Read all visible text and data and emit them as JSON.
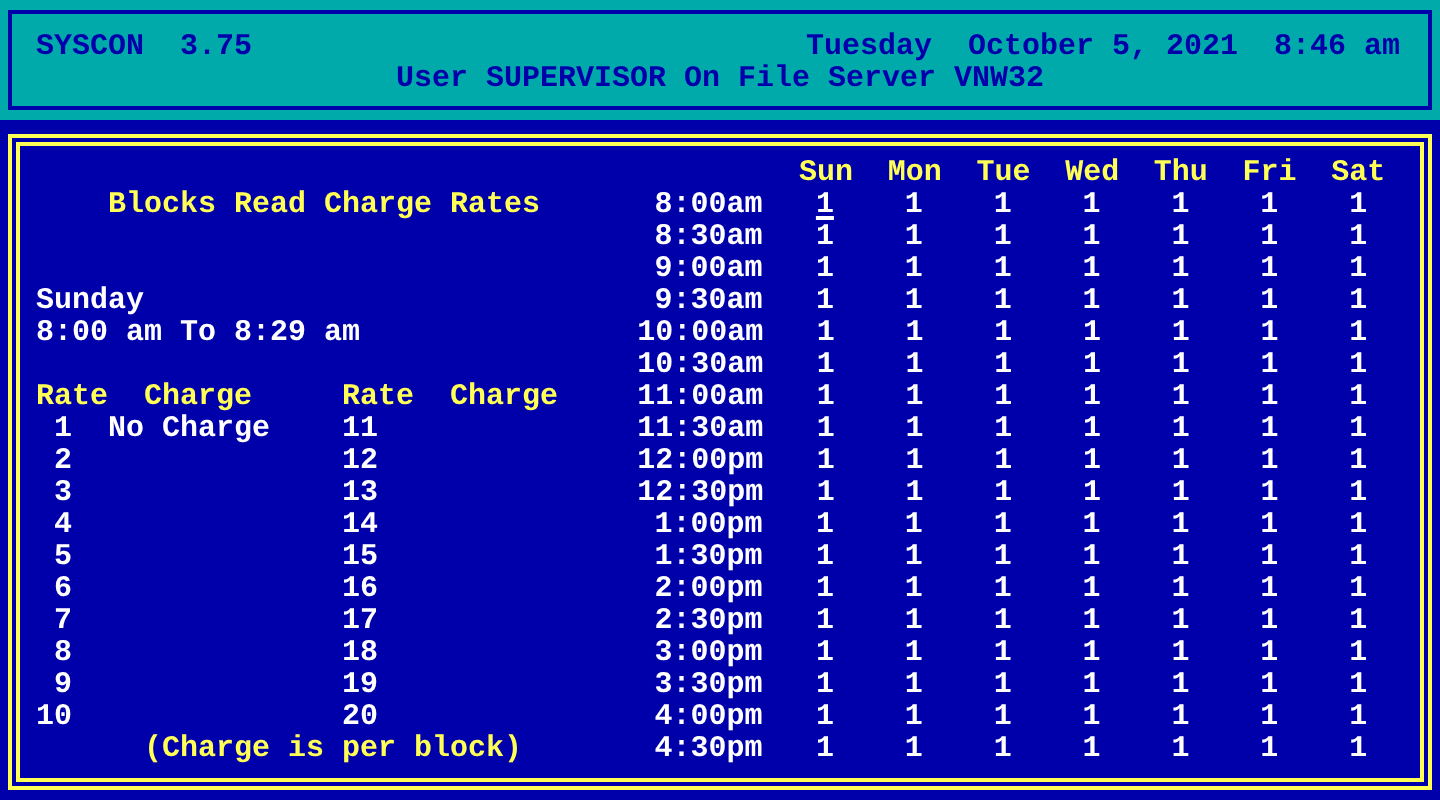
{
  "header": {
    "app": "SYSCON",
    "version": "3.75",
    "datetime": "Tuesday  October 5, 2021  8:46 am",
    "user_line": "User SUPERVISOR On File Server VNW32"
  },
  "left": {
    "heading": "Blocks Read Charge Rates",
    "day": "Sunday",
    "range": "8:00 am To 8:29 am",
    "rate_columns": [
      "Rate",
      "Charge",
      "Rate",
      "Charge"
    ],
    "rates": [
      {
        "rate": "1",
        "charge": "No Charge",
        "rate_2": "11"
      },
      {
        "rate": "2",
        "rate_2": "12"
      },
      {
        "rate": "3",
        "rate_2": "13"
      },
      {
        "rate": "4",
        "rate_2": "14"
      },
      {
        "rate": "5",
        "rate_2": "15"
      },
      {
        "rate": "6",
        "rate_2": "16"
      },
      {
        "rate": "7",
        "rate_2": "17"
      },
      {
        "rate": "8",
        "rate_2": "18"
      },
      {
        "rate": "9",
        "rate_2": "19"
      },
      {
        "rate": "10",
        "rate_2": "20"
      }
    ],
    "footnote": "(Charge is per block)"
  },
  "days": [
    "Sun",
    "Mon",
    "Tue",
    "Wed",
    "Thu",
    "Fri",
    "Sat"
  ],
  "rows": [
    {
      "time": "8:00am",
      "cells": [
        {
          "value": "1",
          "selected": true
        },
        {
          "value": "1",
          "selected": false
        },
        {
          "value": "1",
          "selected": false
        },
        {
          "value": "1",
          "selected": false
        },
        {
          "value": "1",
          "selected": false
        },
        {
          "value": "1",
          "selected": false
        },
        {
          "value": "1",
          "selected": false
        }
      ]
    },
    {
      "time": "8:30am",
      "cells": [
        {
          "value": "1",
          "selected": false
        },
        {
          "value": "1",
          "selected": false
        },
        {
          "value": "1",
          "selected": false
        },
        {
          "value": "1",
          "selected": false
        },
        {
          "value": "1",
          "selected": false
        },
        {
          "value": "1",
          "selected": false
        },
        {
          "value": "1",
          "selected": false
        }
      ]
    },
    {
      "time": "9:00am",
      "cells": [
        {
          "value": "1",
          "selected": false
        },
        {
          "value": "1",
          "selected": false
        },
        {
          "value": "1",
          "selected": false
        },
        {
          "value": "1",
          "selected": false
        },
        {
          "value": "1",
          "selected": false
        },
        {
          "value": "1",
          "selected": false
        },
        {
          "value": "1",
          "selected": false
        }
      ]
    },
    {
      "time": "9:30am",
      "cells": [
        {
          "value": "1",
          "selected": false
        },
        {
          "value": "1",
          "selected": false
        },
        {
          "value": "1",
          "selected": false
        },
        {
          "value": "1",
          "selected": false
        },
        {
          "value": "1",
          "selected": false
        },
        {
          "value": "1",
          "selected": false
        },
        {
          "value": "1",
          "selected": false
        }
      ]
    },
    {
      "time": "10:00am",
      "cells": [
        {
          "value": "1",
          "selected": false
        },
        {
          "value": "1",
          "selected": false
        },
        {
          "value": "1",
          "selected": false
        },
        {
          "value": "1",
          "selected": false
        },
        {
          "value": "1",
          "selected": false
        },
        {
          "value": "1",
          "selected": false
        },
        {
          "value": "1",
          "selected": false
        }
      ]
    },
    {
      "time": "10:30am",
      "cells": [
        {
          "value": "1",
          "selected": false
        },
        {
          "value": "1",
          "selected": false
        },
        {
          "value": "1",
          "selected": false
        },
        {
          "value": "1",
          "selected": false
        },
        {
          "value": "1",
          "selected": false
        },
        {
          "value": "1",
          "selected": false
        },
        {
          "value": "1",
          "selected": false
        }
      ]
    },
    {
      "time": "11:00am",
      "cells": [
        {
          "value": "1",
          "selected": false
        },
        {
          "value": "1",
          "selected": false
        },
        {
          "value": "1",
          "selected": false
        },
        {
          "value": "1",
          "selected": false
        },
        {
          "value": "1",
          "selected": false
        },
        {
          "value": "1",
          "selected": false
        },
        {
          "value": "1",
          "selected": false
        }
      ]
    },
    {
      "time": "11:30am",
      "cells": [
        {
          "value": "1",
          "selected": false
        },
        {
          "value": "1",
          "selected": false
        },
        {
          "value": "1",
          "selected": false
        },
        {
          "value": "1",
          "selected": false
        },
        {
          "value": "1",
          "selected": false
        },
        {
          "value": "1",
          "selected": false
        },
        {
          "value": "1",
          "selected": false
        }
      ]
    },
    {
      "time": "12:00pm",
      "cells": [
        {
          "value": "1",
          "selected": false
        },
        {
          "value": "1",
          "selected": false
        },
        {
          "value": "1",
          "selected": false
        },
        {
          "value": "1",
          "selected": false
        },
        {
          "value": "1",
          "selected": false
        },
        {
          "value": "1",
          "selected": false
        },
        {
          "value": "1",
          "selected": false
        }
      ]
    },
    {
      "time": "12:30pm",
      "cells": [
        {
          "value": "1",
          "selected": false
        },
        {
          "value": "1",
          "selected": false
        },
        {
          "value": "1",
          "selected": false
        },
        {
          "value": "1",
          "selected": false
        },
        {
          "value": "1",
          "selected": false
        },
        {
          "value": "1",
          "selected": false
        },
        {
          "value": "1",
          "selected": false
        }
      ]
    },
    {
      "time": "1:00pm",
      "cells": [
        {
          "value": "1",
          "selected": false
        },
        {
          "value": "1",
          "selected": false
        },
        {
          "value": "1",
          "selected": false
        },
        {
          "value": "1",
          "selected": false
        },
        {
          "value": "1",
          "selected": false
        },
        {
          "value": "1",
          "selected": false
        },
        {
          "value": "1",
          "selected": false
        }
      ]
    },
    {
      "time": "1:30pm",
      "cells": [
        {
          "value": "1",
          "selected": false
        },
        {
          "value": "1",
          "selected": false
        },
        {
          "value": "1",
          "selected": false
        },
        {
          "value": "1",
          "selected": false
        },
        {
          "value": "1",
          "selected": false
        },
        {
          "value": "1",
          "selected": false
        },
        {
          "value": "1",
          "selected": false
        }
      ]
    },
    {
      "time": "2:00pm",
      "cells": [
        {
          "value": "1",
          "selected": false
        },
        {
          "value": "1",
          "selected": false
        },
        {
          "value": "1",
          "selected": false
        },
        {
          "value": "1",
          "selected": false
        },
        {
          "value": "1",
          "selected": false
        },
        {
          "value": "1",
          "selected": false
        },
        {
          "value": "1",
          "selected": false
        }
      ]
    },
    {
      "time": "2:30pm",
      "cells": [
        {
          "value": "1",
          "selected": false
        },
        {
          "value": "1",
          "selected": false
        },
        {
          "value": "1",
          "selected": false
        },
        {
          "value": "1",
          "selected": false
        },
        {
          "value": "1",
          "selected": false
        },
        {
          "value": "1",
          "selected": false
        },
        {
          "value": "1",
          "selected": false
        }
      ]
    },
    {
      "time": "3:00pm",
      "cells": [
        {
          "value": "1",
          "selected": false
        },
        {
          "value": "1",
          "selected": false
        },
        {
          "value": "1",
          "selected": false
        },
        {
          "value": "1",
          "selected": false
        },
        {
          "value": "1",
          "selected": false
        },
        {
          "value": "1",
          "selected": false
        },
        {
          "value": "1",
          "selected": false
        }
      ]
    },
    {
      "time": "3:30pm",
      "cells": [
        {
          "value": "1",
          "selected": false
        },
        {
          "value": "1",
          "selected": false
        },
        {
          "value": "1",
          "selected": false
        },
        {
          "value": "1",
          "selected": false
        },
        {
          "value": "1",
          "selected": false
        },
        {
          "value": "1",
          "selected": false
        },
        {
          "value": "1",
          "selected": false
        }
      ]
    },
    {
      "time": "4:00pm",
      "cells": [
        {
          "value": "1",
          "selected": false
        },
        {
          "value": "1",
          "selected": false
        },
        {
          "value": "1",
          "selected": false
        },
        {
          "value": "1",
          "selected": false
        },
        {
          "value": "1",
          "selected": false
        },
        {
          "value": "1",
          "selected": false
        },
        {
          "value": "1",
          "selected": false
        }
      ]
    },
    {
      "time": "4:30pm",
      "cells": [
        {
          "value": "1",
          "selected": false
        },
        {
          "value": "1",
          "selected": false
        },
        {
          "value": "1",
          "selected": false
        },
        {
          "value": "1",
          "selected": false
        },
        {
          "value": "1",
          "selected": false
        },
        {
          "value": "1",
          "selected": false
        },
        {
          "value": "1",
          "selected": false
        }
      ]
    }
  ]
}
